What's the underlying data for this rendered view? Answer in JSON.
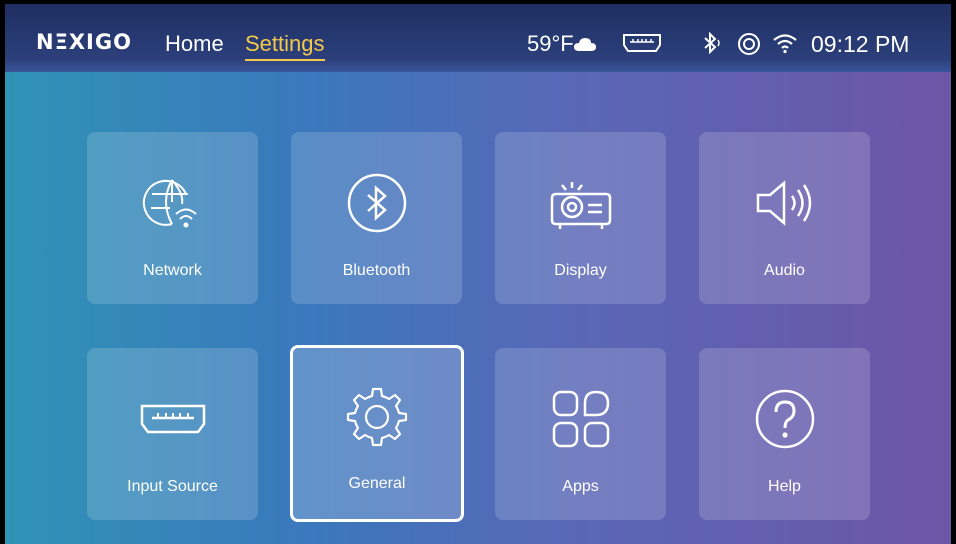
{
  "brand": {
    "logo_text": "NΞXIGO"
  },
  "nav": {
    "home_label": "Home",
    "settings_label": "Settings",
    "active": "Settings"
  },
  "status": {
    "weather_text": "59°F",
    "weather_icon": "cloud-icon",
    "icons": [
      "hdmi-icon",
      "bluetooth-icon",
      "screen-mirror-icon",
      "wifi-icon"
    ],
    "time": "09:12 PM"
  },
  "colors": {
    "accent": "#f2c94c",
    "tile_focus_border": "#ffffff"
  },
  "tiles": [
    {
      "label": "Network",
      "icon": "globe-wifi-icon"
    },
    {
      "label": "Bluetooth",
      "icon": "bluetooth-circle-icon"
    },
    {
      "label": "Display",
      "icon": "projector-icon"
    },
    {
      "label": "Audio",
      "icon": "speaker-icon"
    },
    {
      "label": "Input Source",
      "icon": "hdmi-port-icon"
    },
    {
      "label": "General",
      "icon": "gear-icon",
      "focused": true
    },
    {
      "label": "Apps",
      "icon": "apps-grid-icon"
    },
    {
      "label": "Help",
      "icon": "help-icon"
    }
  ]
}
